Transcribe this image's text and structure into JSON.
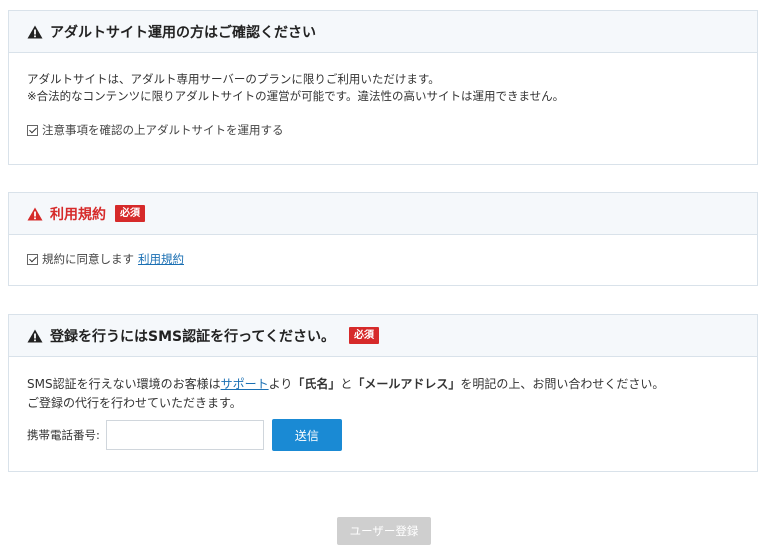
{
  "panel_adult": {
    "title": "アダルトサイト運用の方はご確認ください",
    "line1": "アダルトサイトは、アダルト専用サーバーのプランに限りご利用いただけます。",
    "line2": "※合法的なコンテンツに限りアダルトサイトの運営が可能です。違法性の高いサイトは運用できません。",
    "checkbox_label": "注意事項を確認の上アダルトサイトを運用する",
    "checked": true
  },
  "panel_terms": {
    "title": "利用規約",
    "required_badge": "必須",
    "checkbox_label": "規約に同意します",
    "terms_link": "利用規約",
    "checked": true
  },
  "panel_sms": {
    "title": "登録を行うにはSMS認証を行ってください。",
    "required_badge": "必須",
    "text_part1": "SMS認証を行えない環境のお客様は",
    "support_link": "サポート",
    "text_part2": "より",
    "name_label": "「氏名」",
    "text_part3": "と",
    "email_label": "「メールアドレス」",
    "text_part4": "を明記の上、お問い合わせください。",
    "line2": "ご登録の代行を行わせていただきます。",
    "phone_label": "携帯電話番号:",
    "phone_value": "",
    "send_button": "送信"
  },
  "register_button": "ユーザー登録",
  "colors": {
    "accent_blue": "#1a8ad4",
    "warning_red": "#d62a2a",
    "header_bg": "#f5f8fb",
    "border": "#d9e2ea",
    "disabled_button": "#cfcfcf"
  }
}
